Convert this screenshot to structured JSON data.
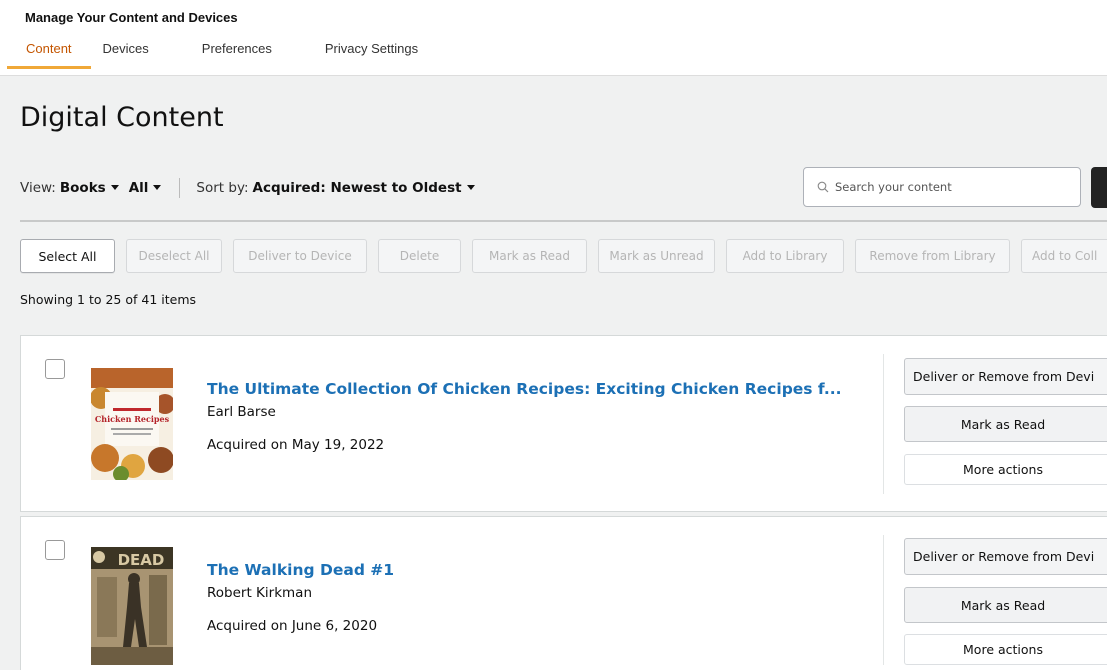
{
  "header": {
    "title": "Manage Your Content and Devices",
    "tabs": [
      {
        "label": "Content",
        "active": true
      },
      {
        "label": "Devices",
        "active": false
      },
      {
        "label": "Preferences",
        "active": false
      },
      {
        "label": "Privacy Settings",
        "active": false
      }
    ]
  },
  "page": {
    "title": "Digital Content"
  },
  "filters": {
    "view_label": "View:",
    "view_type": "Books",
    "view_filter": "All",
    "sort_label": "Sort by:",
    "sort_value": "Acquired: Newest to Oldest"
  },
  "search": {
    "placeholder": "Search your content"
  },
  "actions": {
    "select_all": "Select All",
    "deselect_all": "Deselect All",
    "deliver_to_device": "Deliver to Device",
    "delete": "Delete",
    "mark_as_read": "Mark as Read",
    "mark_as_unread": "Mark as Unread",
    "add_to_library": "Add to Library",
    "remove_from_library": "Remove from Library",
    "add_to_collection": "Add to Coll"
  },
  "results": {
    "showing": "Showing 1 to 25 of 41 items"
  },
  "items": [
    {
      "title": "The Ultimate Collection Of Chicken Recipes: Exciting Chicken Recipes f...",
      "author": "Earl Barse",
      "acquired": "Acquired on May 19, 2022",
      "cover_text": "Chicken Recipes",
      "deliver_label": "Deliver or Remove from Devi",
      "mark_label": "Mark as Read",
      "more_label": "More actions"
    },
    {
      "title": "The Walking Dead #1",
      "author": "Robert Kirkman",
      "acquired": "Acquired on June 6, 2020",
      "cover_text": "DEAD",
      "deliver_label": "Deliver or Remove from Devi",
      "mark_label": "Mark as Read",
      "more_label": "More actions"
    }
  ],
  "colors": {
    "accent": "#f0a838",
    "active_tab_text": "#c45500",
    "link": "#1c70b5",
    "background": "#f0f1f1"
  }
}
